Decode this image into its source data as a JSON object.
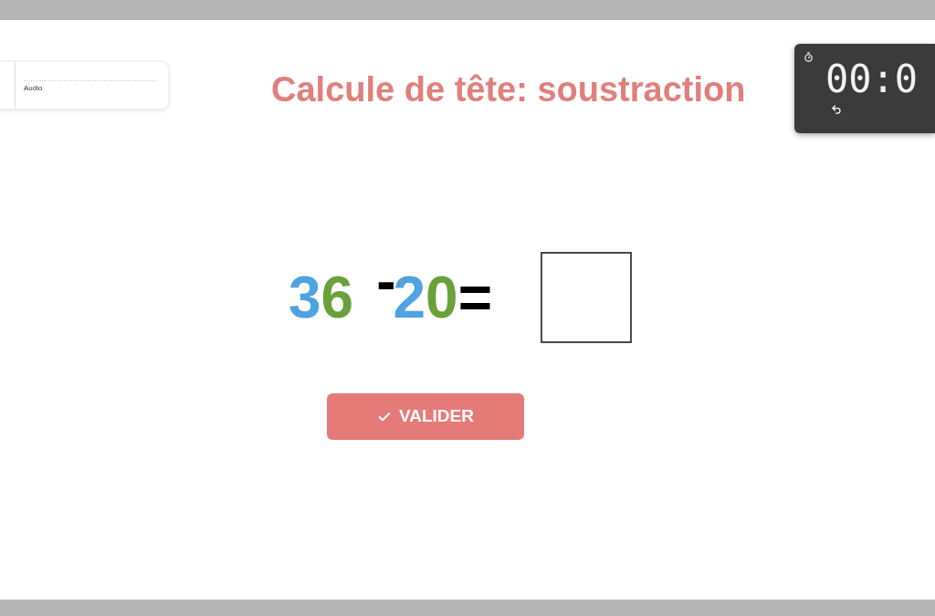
{
  "card": {
    "label": "Audio"
  },
  "title": "Calcule de tête: soustraction",
  "timer": {
    "display": "00:0"
  },
  "equation": {
    "operands": [
      {
        "digits": [
          {
            "text": "3",
            "color": "#4ea3e0"
          },
          {
            "text": "6",
            "color": "#6aa13a"
          }
        ]
      },
      {
        "digits": [
          {
            "text": "2",
            "color": "#4ea3e0"
          },
          {
            "text": "0",
            "color": "#6aa13a"
          }
        ]
      }
    ],
    "operator": "-",
    "equals": "="
  },
  "validate_button": {
    "label": "VALIDER"
  }
}
